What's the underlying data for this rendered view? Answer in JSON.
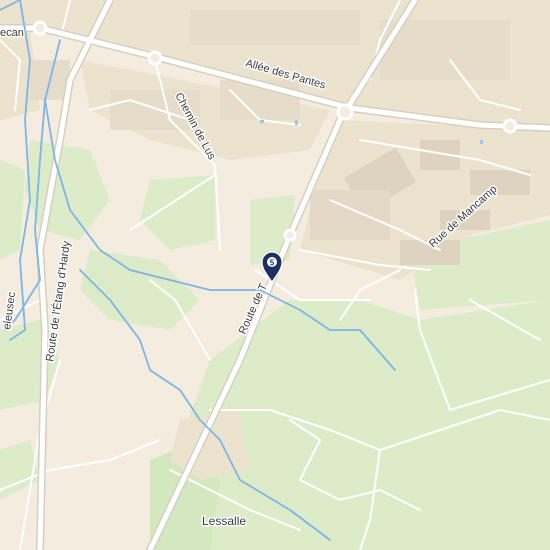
{
  "map": {
    "colors": {
      "land": "#f3ecdf",
      "forest": "#dcecc9",
      "urban": "#ece3cf",
      "building": "#d9d0be",
      "road_main": "#ffffff",
      "road_outline": "#d8d2c6",
      "water": "#7fb4e6",
      "marker": "#1f2f63"
    },
    "labels": {
      "road_allee_pantes": "Allée des Pantes",
      "road_chemin_lus": "Chemin de Lus",
      "road_route_etang": "Route de l'Étang d'Hardy",
      "road_route_de_t": "Route de T",
      "road_rue_mancamp": "Rue de Mancamp",
      "place_lessalle": "Lessalle",
      "edge_ecan": "ecan",
      "edge_eleusec": "eleusec"
    },
    "marker": {
      "icon": "location-pin-icon",
      "glyph": "5"
    }
  }
}
